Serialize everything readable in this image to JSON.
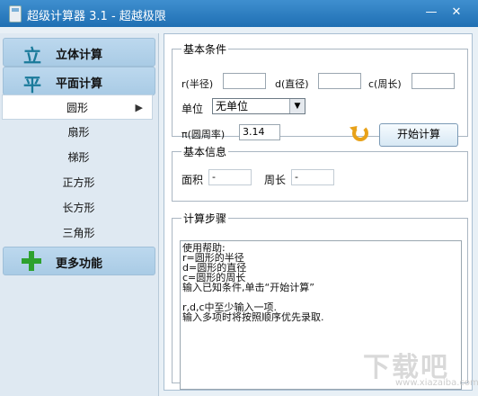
{
  "window": {
    "title": "超级计算器 3.1 - 超越极限",
    "minimize_label": "—",
    "close_label": "✕"
  },
  "sidebar": {
    "categories": {
      "solid": {
        "label": "立体计算",
        "icon": "solid-calc-icon"
      },
      "plane": {
        "label": "平面计算",
        "icon": "plane-calc-icon"
      },
      "more": {
        "label": "更多功能",
        "icon": "plus-icon"
      }
    },
    "plane_items": [
      "圆形",
      "扇形",
      "梯形",
      "正方形",
      "长方形",
      "三角形"
    ],
    "active_item": "圆形"
  },
  "basic": {
    "legend": "基本条件",
    "r_label": "r(半径)",
    "d_label": "d(直径)",
    "c_label": "c(周长)",
    "r_value": "",
    "d_value": "",
    "c_value": "",
    "unit_label": "单位",
    "unit_value": "无单位",
    "pi_label": "π(圆周率)",
    "pi_value": "3.14",
    "calc_button": "开始计算"
  },
  "info": {
    "legend": "基本信息",
    "area_label": "面积",
    "area_value": "-",
    "perimeter_label": "周长",
    "perimeter_value": "-"
  },
  "steps": {
    "legend": "计算步骤",
    "lines": [
      "使用帮助:",
      "r=圆形的半径",
      "d=圆形的直径",
      "c=圆形的周长",
      "输入已知条件,单击“开始计算”",
      "",
      "r,d,c中至少输入一项.",
      "输入多项时将按照顺序优先录取."
    ]
  },
  "watermark": {
    "main": "下载吧",
    "sub": "www.xiazaiba.com"
  }
}
